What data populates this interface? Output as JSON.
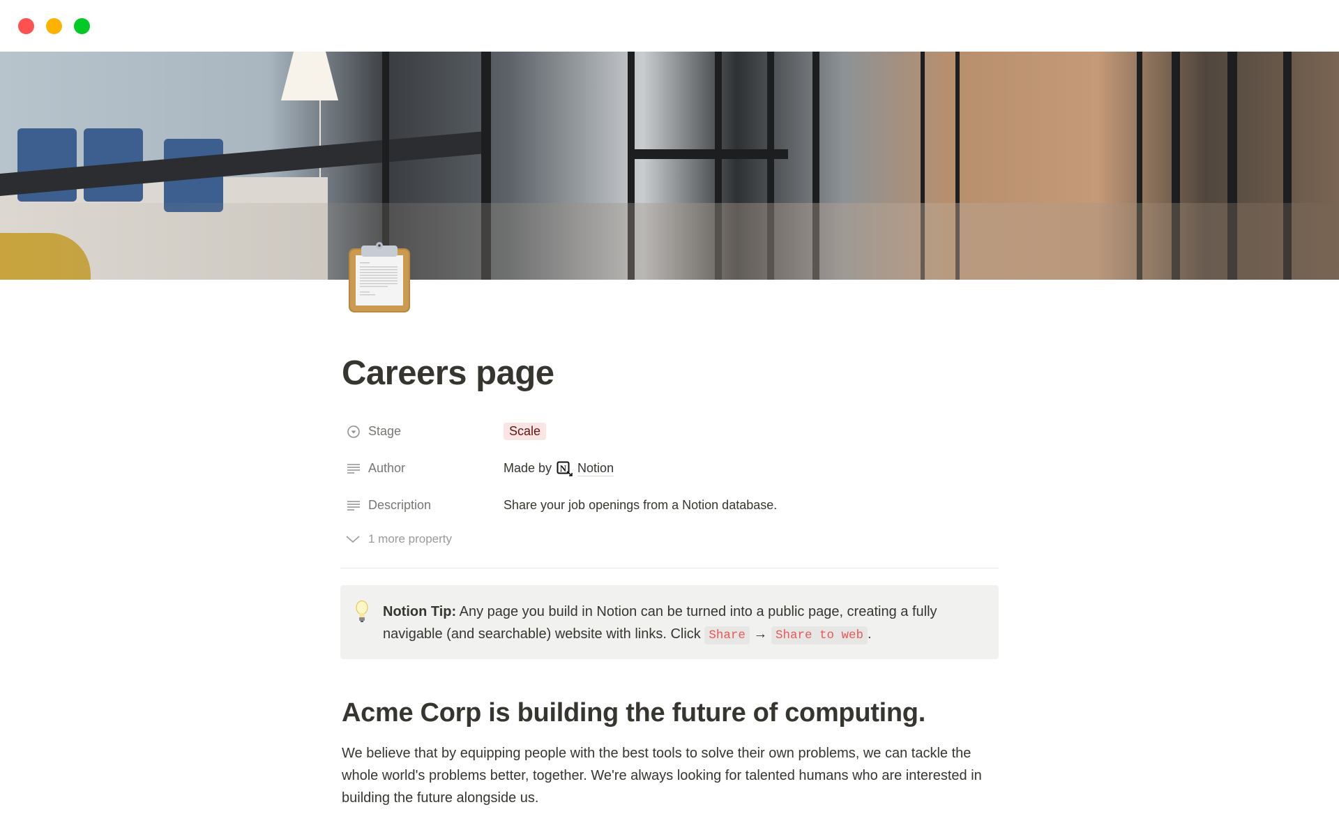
{
  "window": {
    "controls": [
      "close",
      "minimize",
      "zoom"
    ],
    "control_colors": {
      "close": "#fe5150",
      "minimize": "#fdb201",
      "zoom": "#03c924"
    }
  },
  "cover": {
    "description": "office corridor with glass walls",
    "icon": "clipboard-icon"
  },
  "page": {
    "title": "Careers page",
    "properties": [
      {
        "icon": "select-icon",
        "name": "Stage",
        "value": "Scale",
        "type": "select",
        "tag_bg": "#fbe4e4",
        "tag_fg": "#5d1715"
      },
      {
        "icon": "text-icon",
        "name": "Author",
        "prefix": "Made by",
        "value": "Notion",
        "type": "mention"
      },
      {
        "icon": "text-icon",
        "name": "Description",
        "value": "Share your job openings from a Notion database.",
        "type": "text"
      }
    ],
    "more_properties": "1 more property"
  },
  "callout": {
    "icon": "lightbulb-icon",
    "bold": "Notion Tip:",
    "text_before": " Any page you build in Notion can be turned into a public page, creating a fully navigable (and searchable) website with links. Click ",
    "code1": "Share",
    "arrow": " → ",
    "code2": "Share to web",
    "text_after": "."
  },
  "section": {
    "heading": "Acme Corp is building the future of computing.",
    "paragraph": "We believe that by equipping people with the best tools to solve their own problems, we can tackle the whole world's problems better, together. We're always looking for talented humans who are interested in building the future alongside us."
  }
}
